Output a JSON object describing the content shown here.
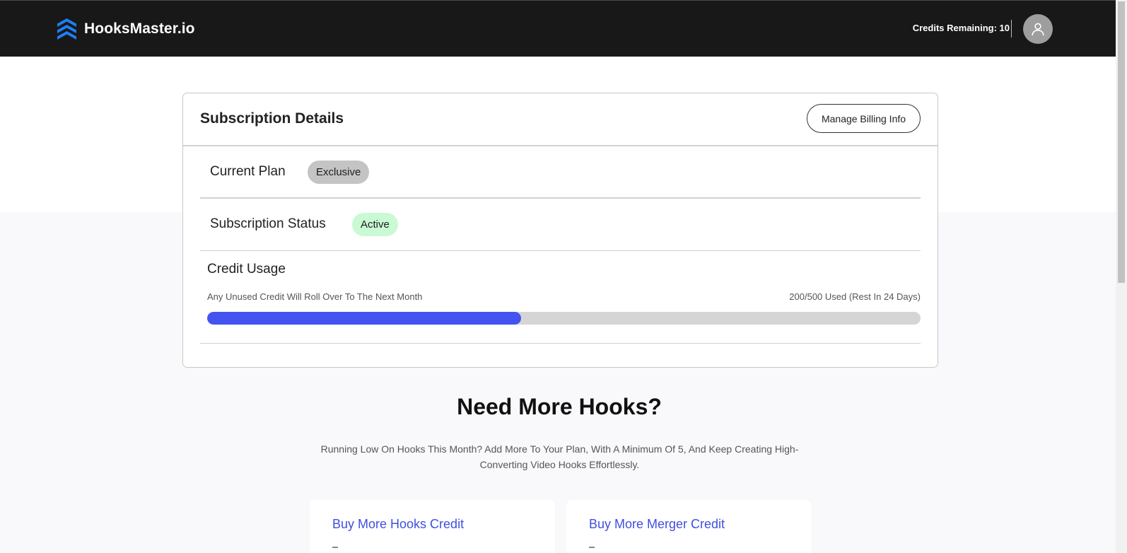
{
  "header": {
    "brand": "HooksMaster.io",
    "credits_remaining": "Credits Remaining: 10",
    "logo_icon": "layered-chevron-logo-icon",
    "avatar_icon": "user-icon",
    "colors": {
      "bar": "#181818",
      "logo": "#1e7ef7"
    }
  },
  "subscription": {
    "title": "Subscription Details",
    "manage_billing_label": "Manage Billing Info",
    "current_plan_label": "Current Plan",
    "current_plan_value": "Exclusive",
    "status_label": "Subscription Status",
    "status_value": "Active",
    "colors": {
      "plan_badge": "#c4c4c4",
      "status_badge": "#c9fad3"
    }
  },
  "credit_usage": {
    "title": "Credit Usage",
    "note": "Any Unused Credit Will Roll Over To The Next Month",
    "used_text": "200/500 Used (Rest In 24 Days)",
    "progress_fraction": 0.44,
    "colors": {
      "fill": "#4353f0",
      "track": "#d5d5d5"
    }
  },
  "upsell": {
    "title": "Need More Hooks?",
    "description": "Running Low On Hooks This Month? Add More To Your Plan, With A Minimum Of 5, And Keep Creating High-Converting Video Hooks Effortlessly.",
    "cards": [
      {
        "title": "Buy More Hooks Credit"
      },
      {
        "title": "Buy More Merger Credit"
      }
    ],
    "accent": "#3e4fe0"
  }
}
